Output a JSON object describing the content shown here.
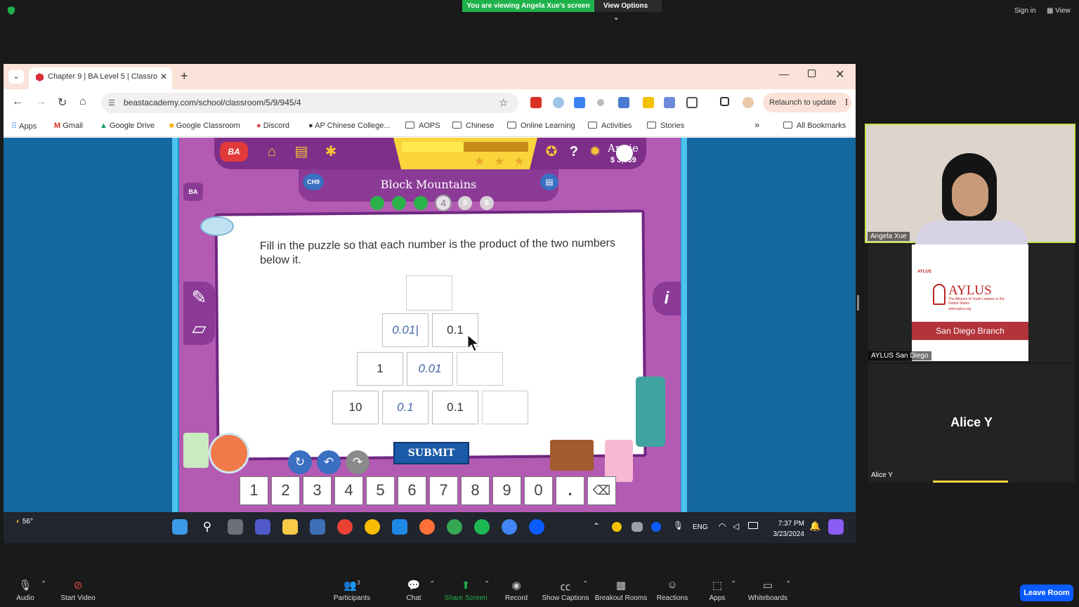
{
  "zoom": {
    "viewing_banner": "You are viewing Angela Xue's screen",
    "view_options": "View Options",
    "sign_in": "Sign in",
    "view": "View",
    "leave_room": "Leave Room",
    "toolbar": [
      {
        "label": "Audio",
        "icon": "mic-icon"
      },
      {
        "label": "Start Video",
        "icon": "video-off-icon"
      },
      {
        "label": "Participants",
        "icon": "participants-icon",
        "count": "3"
      },
      {
        "label": "Chat",
        "icon": "chat-icon"
      },
      {
        "label": "Share Screen",
        "icon": "share-screen-icon"
      },
      {
        "label": "Record",
        "icon": "record-icon"
      },
      {
        "label": "Show Captions",
        "icon": "captions-icon"
      },
      {
        "label": "Breakout Rooms",
        "icon": "breakout-icon"
      },
      {
        "label": "Reactions",
        "icon": "reactions-icon"
      },
      {
        "label": "Apps",
        "icon": "apps-icon"
      },
      {
        "label": "Whiteboards",
        "icon": "whiteboard-icon"
      }
    ],
    "share_color": "#1fb24b"
  },
  "participants": [
    {
      "name": "Angela Xue"
    },
    {
      "name": "AYLUS San Diego",
      "logo_text": "AYLUS",
      "logo_tagline": "The Alliance of Youth Leaders in the United States",
      "logo_url": "www.aylus.org",
      "small_brand": "AYLUS",
      "branch": "San Diego Branch"
    },
    {
      "name": "Alice Y",
      "display": "Alice Y"
    }
  ],
  "browser": {
    "tab_title": "Chapter 9 | BA Level 5 | Classro",
    "url": "beastacademy.com/school/classroom/5/9/945/4",
    "relaunch": "Relaunch to update",
    "bookmarks": [
      "Apps",
      "Gmail",
      "Google Drive",
      "Google Classroom",
      "Discord",
      "AP Chinese College...",
      "AOPS",
      "Chinese",
      "Online Learning",
      "Activities",
      "Stories"
    ],
    "all_bookmarks": "All Bookmarks"
  },
  "game": {
    "logo": "BA",
    "chapter_badge": "CH9",
    "user": "Annie",
    "coins": "3,939",
    "title": "Block Mountains",
    "dots": [
      "1",
      "2",
      "3",
      "4",
      "5",
      "6"
    ],
    "question": "Fill in the puzzle so that each number is the product of the two numbers below it.",
    "puzzle": {
      "row1": [
        ""
      ],
      "row2": [
        "0.01|",
        "0.1"
      ],
      "row3": [
        "1",
        "0.01",
        ""
      ],
      "row4": [
        "10",
        "0.1",
        "0.1",
        ""
      ]
    },
    "submit": "SUBMIT",
    "keys": [
      "1",
      "2",
      "3",
      "4",
      "5",
      "6",
      "7",
      "8",
      "9",
      "0",
      ".",
      "⌫"
    ]
  },
  "taskbar": {
    "weather": "56°",
    "lang": "ENG",
    "time": "7:37 PM",
    "date": "3/23/2024"
  }
}
